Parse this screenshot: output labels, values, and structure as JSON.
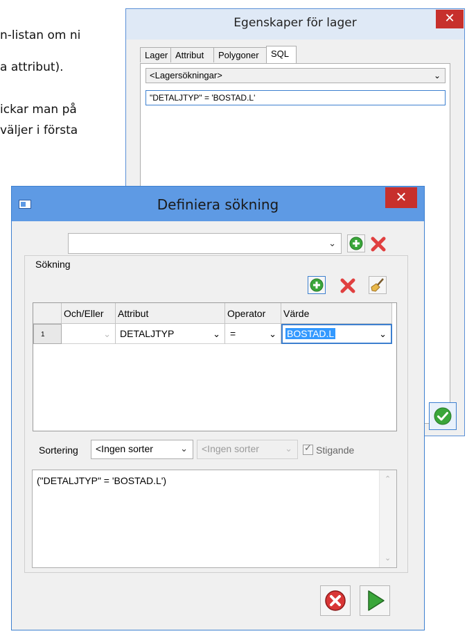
{
  "doc": {
    "line1": "n-listan om ni",
    "line2": "a attribut).",
    "line3": "ickar man på",
    "line4": "väljer i första"
  },
  "win1": {
    "title": "Egenskaper för lager",
    "close": "✕",
    "tabs": [
      "Lager",
      "Attribut",
      "Polygoner",
      "SQL"
    ],
    "active_tab": "SQL",
    "lager_combo": "<Lagersökningar>",
    "sql_text": "\"DETALJTYP\" = 'BOSTAD.L'"
  },
  "win2": {
    "title": "Definiera sökning",
    "close": "✕",
    "search_combo_value": "",
    "group_label": "Sökning",
    "columns": [
      "Och/Eller",
      "Attribut",
      "Operator",
      "Värde"
    ],
    "rows": [
      {
        "num": "1",
        "och_eller": "",
        "attribut": "DETALJTYP",
        "operator": "=",
        "varde": "BOSTAD.L"
      }
    ],
    "sort_label": "Sortering",
    "sort1": "<Ingen sorter",
    "sort2": "<Ingen sorter",
    "stigande": "Stigande",
    "stigande_checked": true,
    "expression": "(\"DETALJTYP\" = 'BOSTAD.L')"
  },
  "icons": {
    "add": "add-icon",
    "delete": "delete-icon",
    "clear": "broom-icon",
    "cancel": "cancel-icon",
    "run": "run-icon",
    "ok": "ok-icon"
  },
  "colors": {
    "accent_blue": "#5e9ae4",
    "close_red": "#c7302c",
    "green": "#3aa63a",
    "red": "#e04040",
    "selection": "#3399ff"
  }
}
